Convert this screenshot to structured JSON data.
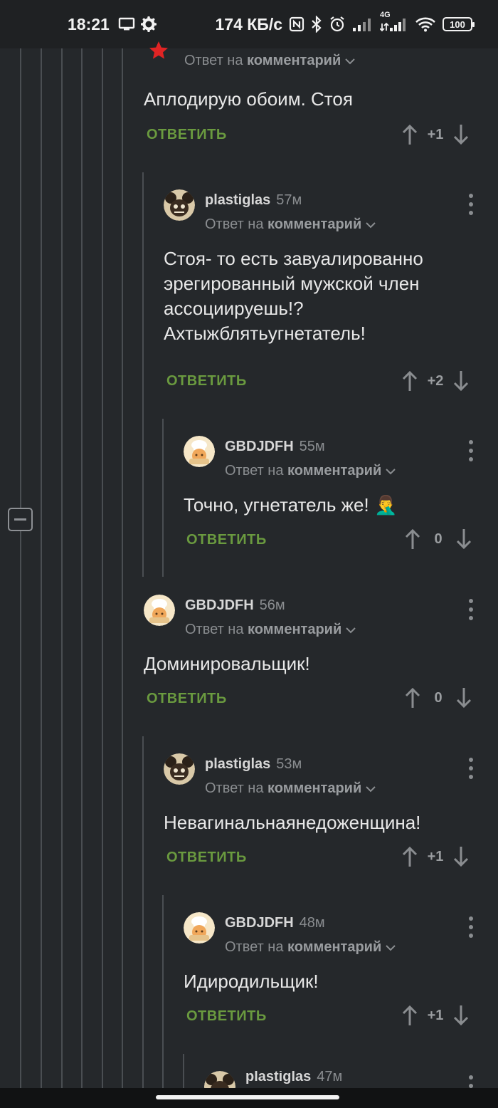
{
  "status_bar": {
    "time": "18:21",
    "speed": "174 КБ/с",
    "network": "4G",
    "battery": "100",
    "icons": [
      "screen-icon",
      "gear-icon",
      "nfc-icon",
      "bluetooth-icon",
      "alarm-icon",
      "signal-icon",
      "signal-4g-icon",
      "wifi-icon",
      "battery-icon"
    ]
  },
  "labels": {
    "reply": "ОТВЕТИТЬ",
    "reply_to_prefix": "Ответ на",
    "reply_to_target": "комментарий"
  },
  "comments": [
    {
      "user": "",
      "age": "",
      "text": "Аплодирую обоим. Стоя",
      "score": "+1"
    },
    {
      "user": "plastiglas",
      "age": "57м",
      "text": "Стоя- то есть завуалированно эрегированный мужской член ассоциируешь!? Ахтыжблятьугнетатель!",
      "score": "+2"
    },
    {
      "user": "GBDJDFH",
      "age": "55м",
      "text": "Точно, угнетатель же! 🤦‍♂️",
      "score": "0"
    },
    {
      "user": "GBDJDFH",
      "age": "56м",
      "text": "Доминировальщик!",
      "score": "0"
    },
    {
      "user": "plastiglas",
      "age": "53м",
      "text": "Невагинальнаянедоженщина!",
      "score": "+1"
    },
    {
      "user": "GBDJDFH",
      "age": "48м",
      "text": "Идиродильщик!",
      "score": "+1"
    },
    {
      "user": "plastiglas",
      "age": "47м",
      "text": "",
      "score": ""
    }
  ]
}
